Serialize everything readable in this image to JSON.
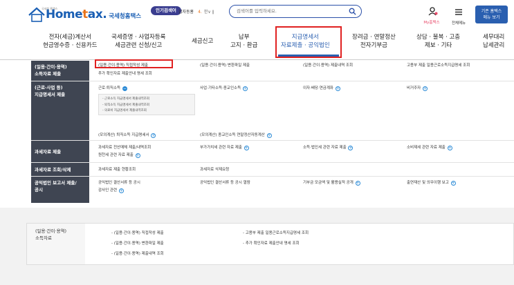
{
  "header": {
    "logo_tiny": "국세청 홈택스",
    "logo_main_1": "Home",
    "logo_main_dot": "t",
    "logo_main_2": "ax.",
    "logo_sub": "국세청홈택스",
    "popular_label": "인기검색어",
    "popular_term": "갑자동홍",
    "popular_rank": "4.",
    "popular_ctrl": "한∨ ∥",
    "search_placeholder": "검색어를 입력하세요.",
    "myhome_label": "My홈택스",
    "allmenu_label": "전체메뉴",
    "btn_old_line1": "기존 홈택스",
    "btn_old_line2": "메뉴 보기"
  },
  "gnb": [
    {
      "line1": "전자(세금)계산서",
      "line2": "현금영수증 · 신용카드"
    },
    {
      "line1": "국세증명 · 사업자등록",
      "line2": "세금관련 신청/신고"
    },
    {
      "line1": "세금신고",
      "line2": ""
    },
    {
      "line1": "납부",
      "line2": "고지 · 환급"
    },
    {
      "line1": "지급명세서",
      "line2": "자료제출 · 공익법인"
    },
    {
      "line1": "장려금 · 연말정산",
      "line2": "전자기부금"
    },
    {
      "line1": "상담 · 불복 · 고충",
      "line2": "제보 · 기타"
    },
    {
      "line1": "세무대리",
      "line2": "납세관리"
    }
  ],
  "mega": {
    "rows": [
      {
        "cat1": "(일용·간이·용역)",
        "cat2": "소득자료 제출"
      },
      {
        "cat1": "(근로·사업 등)",
        "cat2": "지급명세서 제출"
      },
      {
        "cat1": "과세자료 제출",
        "cat2": ""
      },
      {
        "cat1": "과세자료 조회/삭제",
        "cat2": ""
      },
      {
        "cat1": "공익법인 보고서 제출/",
        "cat2": "공시"
      }
    ],
    "r1": {
      "a": "(일용·간이·용역) 직접작성 제출",
      "b": "추가 확인자료 제출안내 명세 조회",
      "c": "(일용·간이·용역) 변환파일 제출",
      "d": "(일용·간이·용역) 제출내역 조회",
      "e": "고용부 제출 일용근로소득지급명세 조회"
    },
    "r2": {
      "a": "근로·퇴직소득",
      "sub1": "- 근로소득 지급명세서 제출내역조회",
      "sub2": "- 퇴직소득 지급명세서 제출내역조회",
      "sub3": "- 의료비 지급명세서 제출내역조회",
      "b": "사업·기타소득·종교인소득",
      "c": "이자·배당·연금계좌",
      "d": "비거주자",
      "e": "(모의계산) 퇴직소득 지급명세서",
      "f": "(모의계산) 종교인소득 연말정산자동계산"
    },
    "r3": {
      "a": "과세자료 전산매체 제출/내역조회",
      "b": "원천세 관련 자료 제출",
      "c": "부가가치세 관련 자료 제출",
      "d": "소득·법인세 관련 자료 제출",
      "e": "소비제세 관련 자료 제출"
    },
    "r4": {
      "a": "과세자료 제출 현황조회",
      "b": "과세자료 삭제요청"
    },
    "r5": {
      "a": "공익법인 결산서류 등 공시",
      "b": "감사인 관련",
      "c": "공익법인 결산서류 등 공시 열람",
      "d": "기부금 모금액 및 활용실적 공개",
      "e": "출연재산 및 의무이행 보고"
    }
  },
  "lower": {
    "cat1": "(일용·간이·용역)",
    "cat2": "소득자료",
    "a": "- (일용·간이·용역) 직접작성 제출",
    "b": "- (일용·간이·용역) 변환파일 제출",
    "c": "- (일용·간이·용역) 제출내역 조회",
    "d": "- 고용부 제출 일용근로소득지급명세 조회",
    "e": "- 추가 확인자료 제출안내 명세 조회"
  },
  "colors": {
    "brand_blue": "#2a5fb0",
    "brand_orange": "#e8731a",
    "category_bg": "#3f4552",
    "highlight_red": "#e02020"
  }
}
